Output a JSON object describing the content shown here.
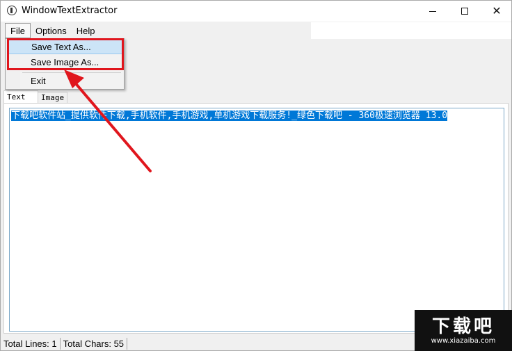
{
  "window": {
    "title": "WindowTextExtractor",
    "icon": "app-icon",
    "controls": {
      "minimize_icon": "minimize-icon",
      "maximize_icon": "maximize-icon",
      "close_icon": "close-icon",
      "close_glyph": "✕"
    }
  },
  "menubar": {
    "items": [
      "File",
      "Options",
      "Help"
    ]
  },
  "file_menu": {
    "items": [
      "Save Text As...",
      "Save Image As...",
      "Exit"
    ],
    "highlighted": "Save Text As..."
  },
  "tabs": [
    "Text",
    "Image"
  ],
  "text_content": "下载吧软件站_提供软件下载,手机软件,手机游戏,单机游戏下载服务!_绿色下载吧 - 360极速浏览器 13.0",
  "status": {
    "lines": "Total Lines: 1",
    "chars": "Total Chars: 55"
  },
  "watermark": {
    "big": "下载吧",
    "small": "www.xiazaiba.com"
  },
  "colors": {
    "annotation_red": "#e0161d",
    "selection_blue": "#0078d7",
    "menu_highlight": "#cce4f7"
  }
}
